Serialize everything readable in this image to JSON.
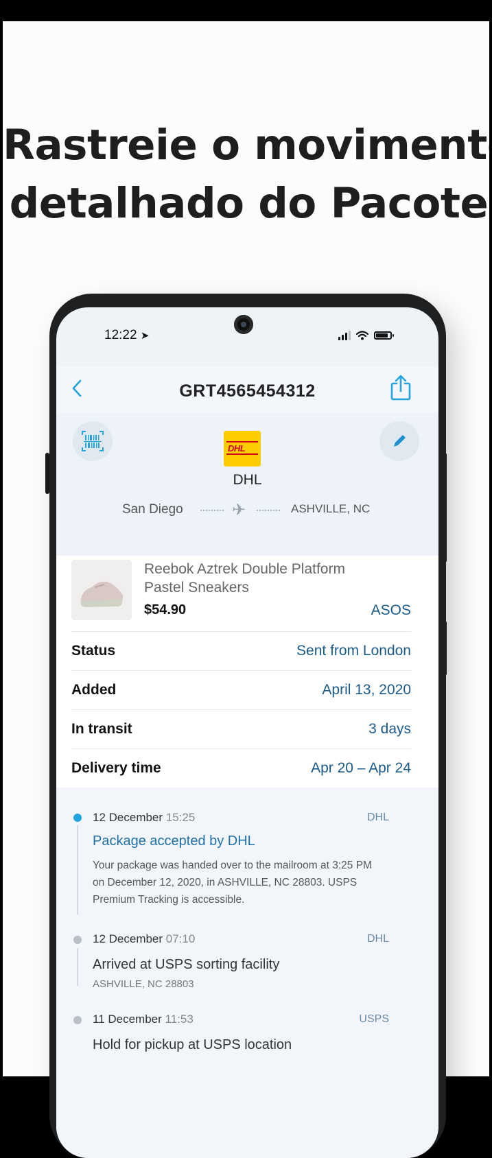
{
  "headline": {
    "line1": "Rastreie o movimento",
    "line2": "detalhado do Pacote"
  },
  "status_bar": {
    "time": "12:22",
    "location_icon": "location-arrow-icon"
  },
  "header": {
    "tracking_number": "GRT4565454312",
    "back_icon": "chevron-left-icon",
    "share_icon": "share-icon"
  },
  "carrier": {
    "name": "DHL",
    "logo_text": "DHL",
    "scan_icon": "barcode-scan-icon",
    "edit_icon": "pencil-icon",
    "from": "San Diego",
    "to": "ASHVILLE, NC"
  },
  "product": {
    "name": "Reebok Aztrek Double Platform Pastel Sneakers",
    "price": "$54.90",
    "store": "ASOS"
  },
  "details": [
    {
      "label": "Status",
      "value": "Sent from London"
    },
    {
      "label": "Added",
      "value": "April 13, 2020"
    },
    {
      "label": "In transit",
      "value": "3 days"
    },
    {
      "label": "Delivery time",
      "value": "Apr 20 – Apr 24"
    }
  ],
  "timeline": [
    {
      "date": "12 December",
      "time": "15:25",
      "carrier": "DHL",
      "title": "Package accepted by DHL",
      "description": "Your package was handed over to the mailroom at 3:25 PM on December 12, 2020, in ASHVILLE, NC 28803. USPS Premium Tracking is accessible."
    },
    {
      "date": "12 December",
      "time": "07:10",
      "carrier": "DHL",
      "title": "Arrived at USPS sorting facility",
      "subtitle": "ASHVILLE, NC 28803"
    },
    {
      "date": "11 December",
      "time": "11:53",
      "carrier": "USPS",
      "title": "Hold for pickup at USPS location"
    }
  ],
  "colors": {
    "accent": "#23a3df",
    "link_blue": "#1a5a88",
    "active_title": "#1f6fa8",
    "dhl_yellow": "#ffcc00",
    "dhl_red": "#d40511"
  }
}
